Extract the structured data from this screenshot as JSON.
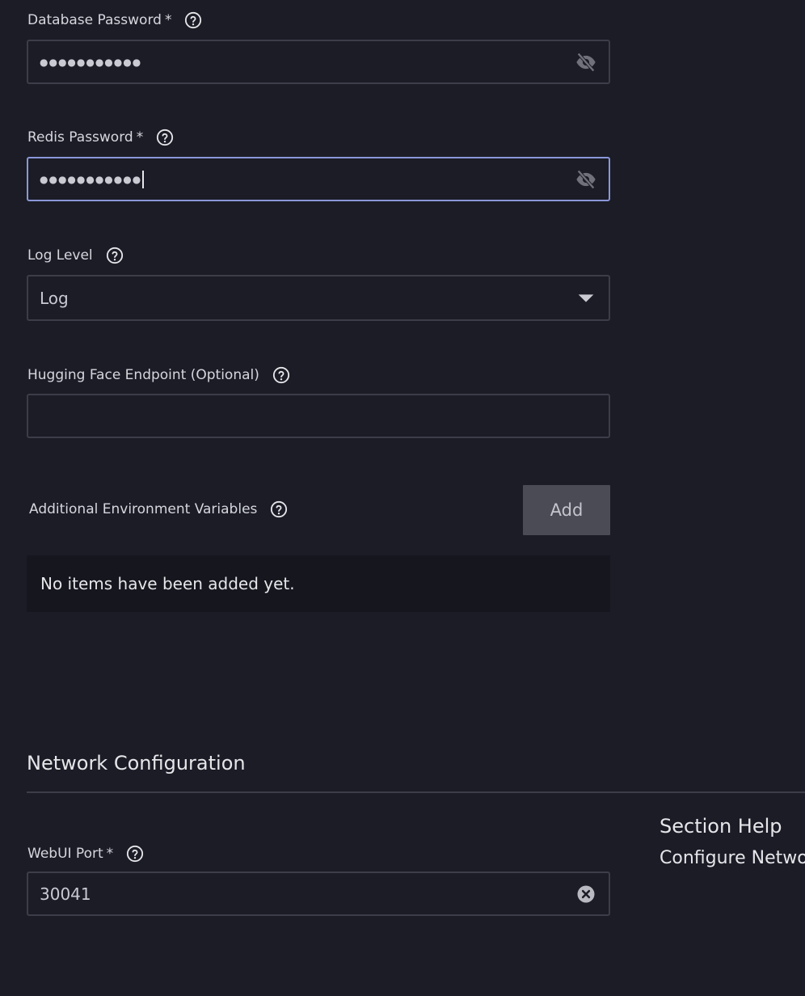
{
  "fields": {
    "db_password": {
      "label": "Database Password",
      "required_mark": "*",
      "masked_value": "●●●●●●●●●●●",
      "toggle_icon": "eye-slash-icon"
    },
    "redis_password": {
      "label": "Redis Password",
      "required_mark": "*",
      "masked_value": "●●●●●●●●●●●",
      "toggle_icon": "eye-slash-icon",
      "focused": true
    },
    "log_level": {
      "label": "Log Level",
      "selected": "Log",
      "icon": "caret-down-icon"
    },
    "hf_endpoint": {
      "label": "Hugging Face Endpoint (Optional)",
      "value": ""
    },
    "env_vars": {
      "label": "Additional Environment Variables",
      "add_label": "Add",
      "empty_text": "No items have been added yet."
    }
  },
  "network": {
    "title": "Network Configuration",
    "webui_port": {
      "label": "WebUI Port",
      "required_mark": "*",
      "value": "30041",
      "clear_icon": "clear-icon"
    }
  },
  "section_help": {
    "title": "Section Help",
    "text": "Configure Network"
  },
  "colors": {
    "background": "#1b1c26",
    "border": "#3c3d48",
    "focus_border": "#8a97d8",
    "button_bg": "#4a4b55"
  }
}
